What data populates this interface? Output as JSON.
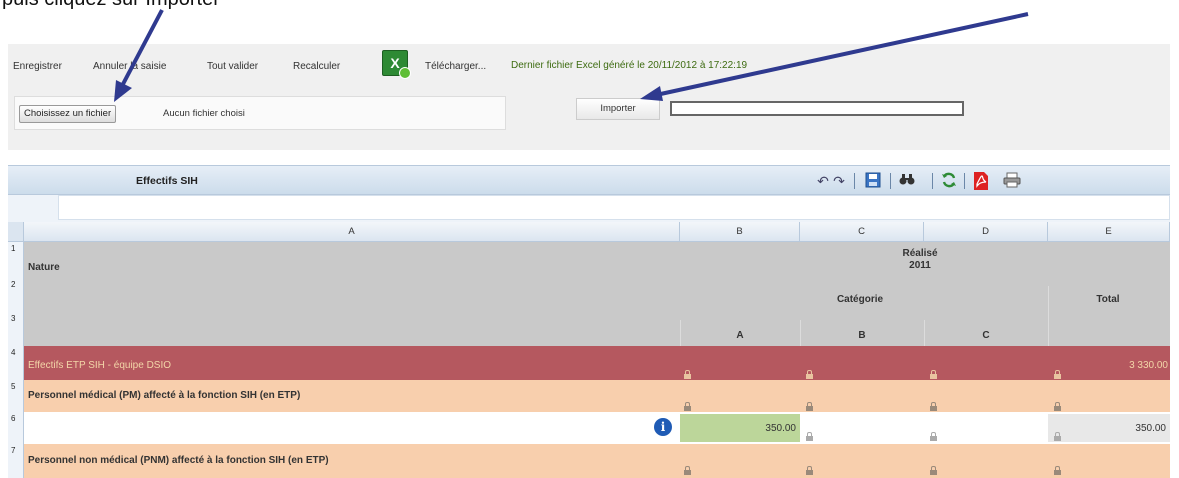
{
  "caption": "puis cliquez sur Importer",
  "toolbar": {
    "enregistrer": "Enregistrer",
    "annuler": "Annuler la saisie",
    "tout_valider": "Tout valider",
    "recalculer": "Recalculer",
    "telecharger": "Télécharger...",
    "last_file": "Dernier fichier Excel généré le 20/11/2012 à 17:22:19",
    "choose_file": "Choisissez un fichier",
    "no_file": "Aucun fichier choisi",
    "importer": "Importer"
  },
  "panel": {
    "title": "Effectifs SIH"
  },
  "columns": [
    "A",
    "B",
    "C",
    "D",
    "E"
  ],
  "header": {
    "nature": "Nature",
    "realise": "Réalisé",
    "year": "2011",
    "categorie": "Catégorie",
    "total": "Total",
    "cat_a": "A",
    "cat_b": "B",
    "cat_c": "C"
  },
  "row_numbers": [
    "1",
    "2",
    "3",
    "4",
    "5",
    "6",
    "7"
  ],
  "rows": {
    "r4_label": "Effectifs ETP SIH - équipe DSIO",
    "r4_total": "3 330.00",
    "r5_label": "Personnel médical (PM) affecté à la fonction SIH (en ETP)",
    "r6_b": "350.00",
    "r6_total": "350.00",
    "r7_label": "Personnel non médical (PNM) affecté à la fonction SIH (en ETP)"
  },
  "colors": {
    "arrow": "#2f3a8f",
    "row4_bg": "#b5585f",
    "row_peach": "#f8cfad",
    "input_green": "#bcd69a",
    "header_gray": "#c9c9c9",
    "last_file_text": "#3d6b10"
  }
}
